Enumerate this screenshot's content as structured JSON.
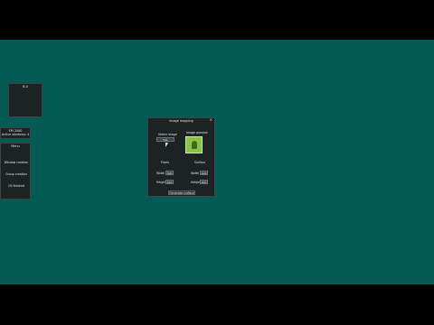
{
  "desktop": {
    "bg_color": "#045b56"
  },
  "small_window": {
    "title": "B-0"
  },
  "status_panel": {
    "line1": "EM 2000",
    "line2": "Active windows: 4"
  },
  "menu": {
    "title": "Menu",
    "items": [
      "Window creation",
      "Group creation",
      "OS finished"
    ]
  },
  "dialog": {
    "title": "Image mapping",
    "close_glyph": "×",
    "select_image_label": "Select image",
    "select_image_button": "File",
    "preview_label": "Image preview",
    "left_section": "Pixels",
    "right_section": "Surface",
    "width_label": "Width",
    "height_label": "Height",
    "left_width": "100",
    "left_height": "100",
    "right_width": "100",
    "right_height": "100",
    "generate_button": "Generate surface",
    "preview_color": "#8bc34a"
  }
}
